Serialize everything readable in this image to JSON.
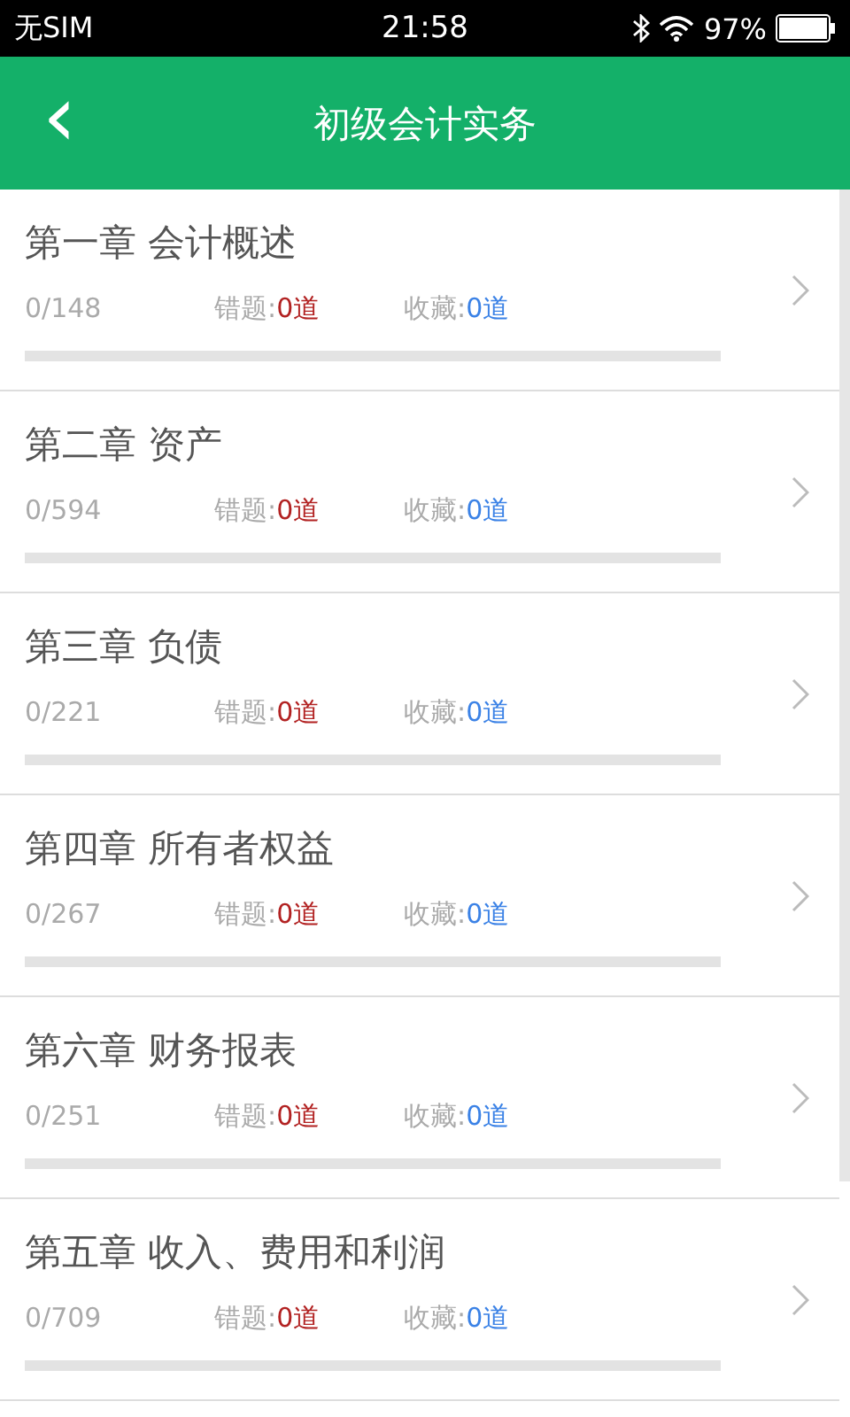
{
  "status_bar": {
    "carrier": "无SIM",
    "time": "21:58",
    "battery": "97%"
  },
  "header": {
    "back": "‹",
    "title": "初级会计实务"
  },
  "chapters": [
    {
      "title": "第一章 会计概述",
      "progress": "0/148",
      "wrong_label": "错题:",
      "wrong_count": "0道",
      "fav_label": "收藏:",
      "fav_count": "0道"
    },
    {
      "title": "第二章 资产",
      "progress": "0/594",
      "wrong_label": "错题:",
      "wrong_count": "0道",
      "fav_label": "收藏:",
      "fav_count": "0道"
    },
    {
      "title": "第三章 负债",
      "progress": "0/221",
      "wrong_label": "错题:",
      "wrong_count": "0道",
      "fav_label": "收藏:",
      "fav_count": "0道"
    },
    {
      "title": "第四章 所有者权益",
      "progress": "0/267",
      "wrong_label": "错题:",
      "wrong_count": "0道",
      "fav_label": "收藏:",
      "fav_count": "0道"
    },
    {
      "title": "第六章 财务报表",
      "progress": "0/251",
      "wrong_label": "错题:",
      "wrong_count": "0道",
      "fav_label": "收藏:",
      "fav_count": "0道"
    },
    {
      "title": "第五章 收入、费用和利润",
      "progress": "0/709",
      "wrong_label": "错题:",
      "wrong_count": "0道",
      "fav_label": "收藏:",
      "fav_count": "0道"
    }
  ]
}
